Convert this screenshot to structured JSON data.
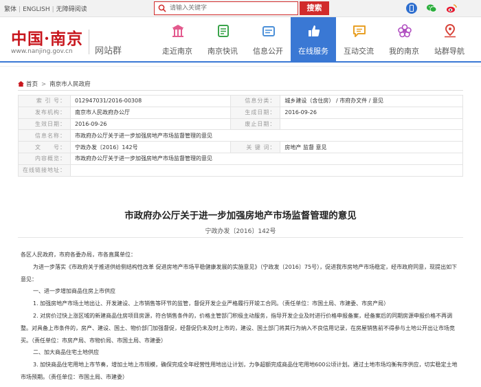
{
  "topbar": {
    "links": [
      "繁体",
      "ENGLISH",
      "无障碍阅读"
    ],
    "search_placeholder": "请输入关键字",
    "search_button": "搜索"
  },
  "header": {
    "logo_text": "中国·南京",
    "logo_url": "www.nanjing.gov.cn",
    "site_group": "网站群",
    "nav": [
      {
        "label": "走近南京",
        "icon": "pavilion-icon",
        "active": false
      },
      {
        "label": "南京快讯",
        "icon": "news-icon",
        "active": false
      },
      {
        "label": "信息公开",
        "icon": "document-icon",
        "active": false
      },
      {
        "label": "在线服务",
        "icon": "thumbs-up-icon",
        "active": true
      },
      {
        "label": "互动交流",
        "icon": "chat-icon",
        "active": false
      },
      {
        "label": "我的南京",
        "icon": "flower-icon",
        "active": false
      },
      {
        "label": "站群导航",
        "icon": "location-pin-icon",
        "active": false
      }
    ],
    "accent_color": "#3a78d4",
    "brand_color": "#c8161d"
  },
  "breadcrumb": {
    "home": "首页",
    "current": "南京市人民政府"
  },
  "meta": {
    "index_key": "索 引 号：",
    "index_val": "012947031/2016-00308",
    "category_key": "信息分类：",
    "category_val": "城乡建设（含住房） / 市府办文件 / 意见",
    "issuer_key": "发布机构：",
    "issuer_val": "南京市人民政府办公厅",
    "gen_date_key": "生成日期：",
    "gen_date_val": "2016-09-26",
    "eff_date_key": "生效日期：",
    "eff_date_val": "2016-09-26",
    "exp_date_key": "废止日期：",
    "exp_date_val": "",
    "name_key": "信息名称：",
    "name_val": "市政府办公厅关于进一步加强房地产市场监督管理的意见",
    "doc_no_key": "文　　号：",
    "doc_no_val": "宁政办发〔2016〕142号",
    "keywords_key": "关 键 词：",
    "keywords_val": "房地产 监督 意见",
    "summary_key": "内容概览：",
    "summary_val": "市政府办公厅关于进一步加强房地产市场监督管理的意见",
    "attachment_key": "在线链接地址：",
    "attachment_val": ""
  },
  "doc": {
    "title": "市政府办公厅关于进一步加强房地产市场监督管理的意见",
    "number": "宁政办发〔2016〕142号",
    "paragraphs": [
      "各区人民政府，市府各委办局，市各直属单位：",
      "为进一步落实《市政府关于推进供给侧结构性改革 促进房地产市场平稳健康发展的实施意见》（宁政发〔2016〕75号），促进我市房地产市场稳定，经市政府同意，现提出如下意见：",
      "一、进一步增加商品住房上市供应",
      "1. 加强房地产市场土地出让、开发建设、上市销售等环节的监管，督促开发企业严格履行开竣工合同。（责任单位：市国土局、市建委、市房产局）",
      "2. 对房价过快上涨区域的新建商品住房项目房源，符合销售条件的，价格主管部门积极主动服务，指导开发企业及时进行价格申报备案，经备案后的同期房源申报价格不再调整。对具备上市条件的，房产、建设、国土、物价部门加强督促，经督促仍未及时上市的，建设、国土部门将其行为纳入不良信用记录，在房屋销售前不得参与土地公开出让市场竞买。（责任单位：市房产局、市物价局、市国土局、市建委）",
      "二、加大商品住宅土地供应",
      "3. 加快商品住宅用地上市节奏，增加土地上市规模，确保完成全年经营性用地出让计划，力争超额完成商品住宅用地600公顷计划。通过土地市场均衡有序供应，切实稳定土地市场预期。（责任单位：市国土局、市建委）"
    ]
  }
}
